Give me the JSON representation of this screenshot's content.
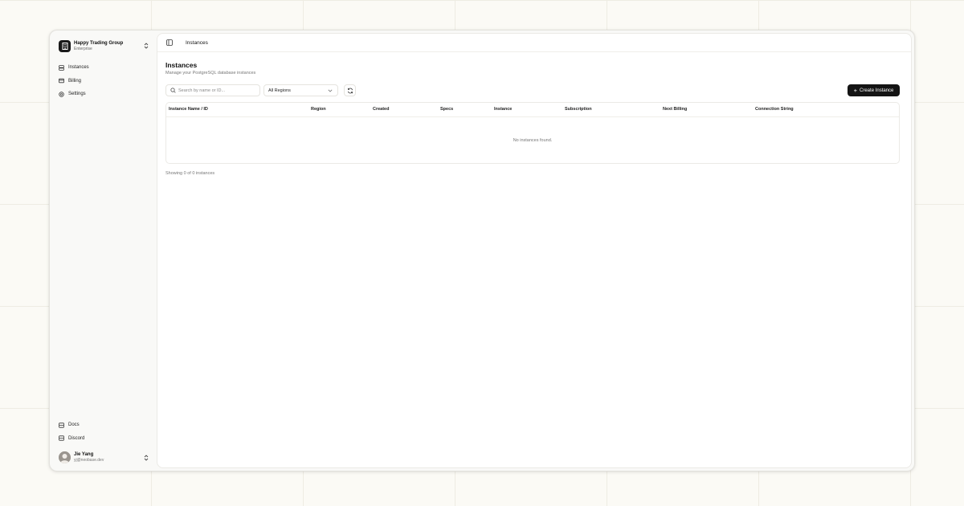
{
  "org": {
    "name": "Happy Trading Group",
    "plan": "Enterprise"
  },
  "sidebar": {
    "items": [
      {
        "label": "Instances",
        "icon": "database-icon"
      },
      {
        "label": "Billing",
        "icon": "credit-card-icon"
      },
      {
        "label": "Settings",
        "icon": "gear-icon"
      }
    ],
    "bottom_items": [
      {
        "label": "Docs",
        "icon": "book-icon"
      },
      {
        "label": "Discord",
        "icon": "chat-icon"
      }
    ]
  },
  "user": {
    "name": "Jie Yang",
    "email": "yj@neobase.dev"
  },
  "topbar": {
    "breadcrumb": "Instances"
  },
  "page": {
    "title": "Instances",
    "subtitle": "Manage your PostgreSQL database instances"
  },
  "toolbar": {
    "search_placeholder": "Search by name or ID...",
    "region_value": "All Regions",
    "create_label": "Create Instance"
  },
  "table": {
    "columns": [
      "Instance Name / ID",
      "Region",
      "Created",
      "Specs",
      "Instance",
      "Subscription",
      "Next Billing",
      "Connection String"
    ],
    "empty_message": "No instances found."
  },
  "footer": {
    "count_text": "Showing 0 of 0 instances"
  },
  "colors": {
    "background": "#fbfaf5",
    "primary_button": "#141414",
    "panel": "#ffffff"
  }
}
